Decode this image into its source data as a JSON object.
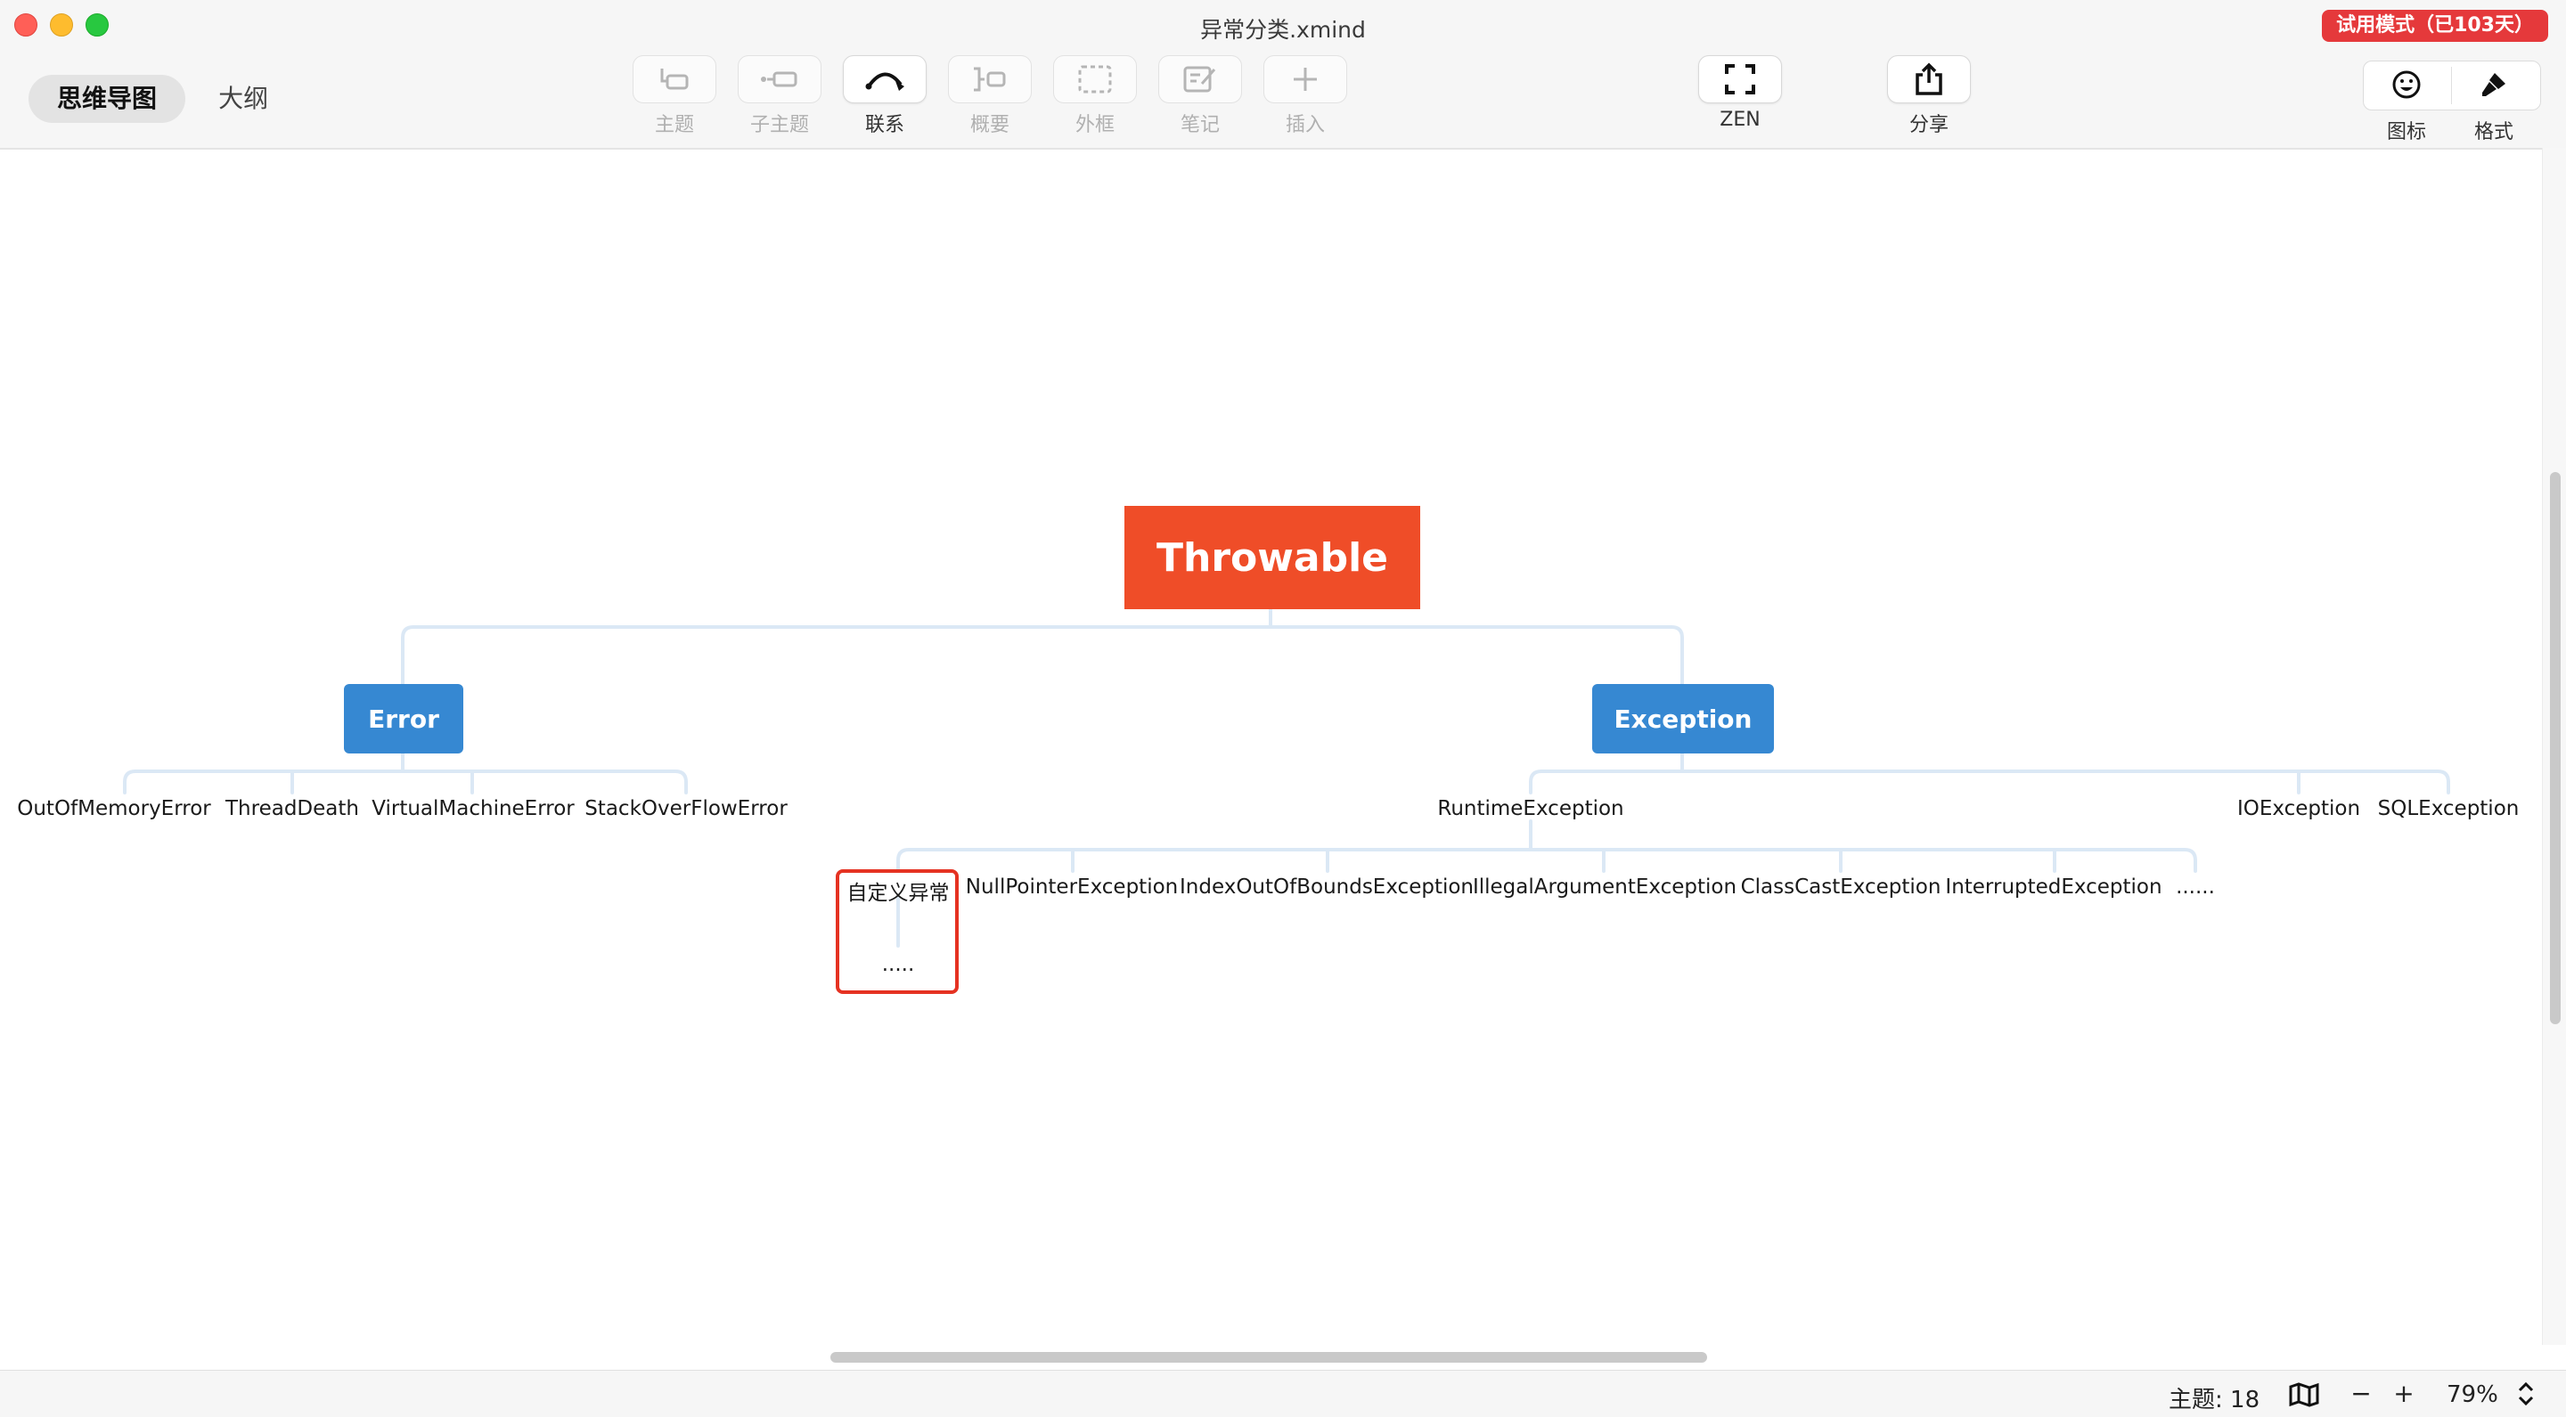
{
  "window": {
    "title": "异常分类.xmind",
    "trial_badge": "试用模式（已103天）"
  },
  "view_switch": {
    "tabs": [
      {
        "label": "思维导图",
        "active": true
      },
      {
        "label": "大纲",
        "active": false
      }
    ]
  },
  "toolbar": {
    "topic": "主题",
    "subtopic": "子主题",
    "relationship": "联系",
    "summary": "概要",
    "boundary": "外框",
    "note": "笔记",
    "insert": "插入",
    "zen": "ZEN",
    "share": "分享",
    "icons": "图标",
    "format": "格式"
  },
  "mindmap": {
    "root": "Throwable",
    "error": {
      "label": "Error",
      "children": [
        "OutOfMemoryError",
        "ThreadDeath",
        "VirtualMachineError",
        "StackOverFlowError"
      ]
    },
    "exception": {
      "label": "Exception",
      "children": [
        "RuntimeException",
        "IOException",
        "SQLException"
      ],
      "runtime_children": [
        "自定义异常",
        "NullPointerException",
        "IndexOutOfBoundsException",
        "IllegalArgumentException",
        "ClassCastException",
        "InterruptedException",
        "......"
      ],
      "custom_child": "....."
    }
  },
  "status": {
    "topic_count": "主题: 18",
    "zoom": "79%"
  },
  "colors": {
    "root": "#ef4d28",
    "main_topic": "#3688d2",
    "highlight": "#e53222",
    "trial_badge": "#e5393b",
    "connector": "#dbe8f5"
  }
}
